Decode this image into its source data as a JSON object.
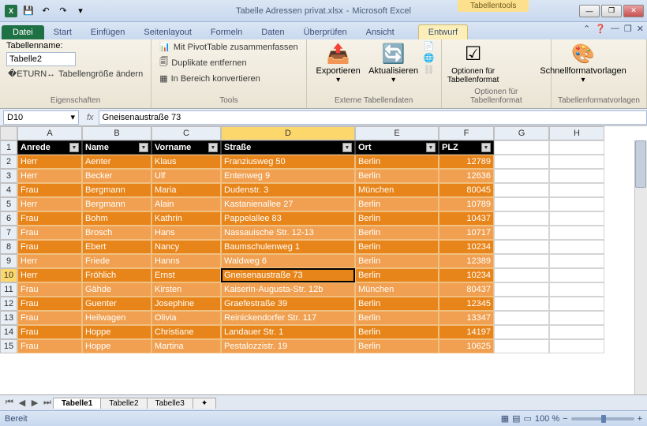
{
  "title": {
    "doc": "Tabelle Adressen privat.xlsx",
    "app": "Microsoft Excel",
    "contextual": "Tabellentools"
  },
  "qat": {
    "save": "💾",
    "undo": "↶",
    "redo": "↷"
  },
  "tabs": {
    "file": "Datei",
    "items": [
      "Start",
      "Einfügen",
      "Seitenlayout",
      "Formeln",
      "Daten",
      "Überprüfen",
      "Ansicht"
    ],
    "contextual": "Entwurf"
  },
  "ribbon": {
    "props": {
      "name_label": "Tabellenname:",
      "name_value": "Tabelle2",
      "resize": "Tabellengröße ändern",
      "group": "Eigenschaften"
    },
    "tools": {
      "pivot": "Mit PivotTable zusammenfassen",
      "dup": "Duplikate entfernen",
      "convert": "In Bereich konvertieren",
      "group": "Tools"
    },
    "external": {
      "export": "Exportieren",
      "refresh": "Aktualisieren",
      "group": "Externe Tabellendaten"
    },
    "styleopts": {
      "label": "Optionen für Tabellenformat",
      "group": "Optionen für Tabellenformat"
    },
    "styles": {
      "label": "Schnellformatvorlagen",
      "group": "Tabellenformatvorlagen"
    }
  },
  "namebox": "D10",
  "formula": "Gneisenaustraße 73",
  "fx": "fx",
  "cols": [
    "A",
    "B",
    "C",
    "D",
    "E",
    "F",
    "G",
    "H"
  ],
  "headers": [
    "Anrede",
    "Name",
    "Vorname",
    "Straße",
    "Ort",
    "PLZ"
  ],
  "rows": [
    {
      "n": 2,
      "a": "Herr",
      "b": "Aenter",
      "c": "Klaus",
      "d": "Franziusweg 50",
      "e": "Berlin",
      "f": "12789"
    },
    {
      "n": 3,
      "a": "Herr",
      "b": "Becker",
      "c": "Ulf",
      "d": "Entenweg 9",
      "e": "Berlin",
      "f": "12636"
    },
    {
      "n": 4,
      "a": "Frau",
      "b": "Bergmann",
      "c": "Maria",
      "d": "Dudenstr. 3",
      "e": "München",
      "f": "80045"
    },
    {
      "n": 5,
      "a": "Herr",
      "b": "Bergmann",
      "c": "Alain",
      "d": "Kastanienallee 27",
      "e": "Berlin",
      "f": "10789"
    },
    {
      "n": 6,
      "a": "Frau",
      "b": "Bohm",
      "c": "Kathrin",
      "d": "Pappelallee 83",
      "e": "Berlin",
      "f": "10437"
    },
    {
      "n": 7,
      "a": "Frau",
      "b": "Brosch",
      "c": "Hans",
      "d": "Nassauische Str. 12-13",
      "e": "Berlin",
      "f": "10717"
    },
    {
      "n": 8,
      "a": "Frau",
      "b": "Ebert",
      "c": "Nancy",
      "d": "Baumschulenweg 1",
      "e": "Berlin",
      "f": "10234"
    },
    {
      "n": 9,
      "a": "Herr",
      "b": "Friede",
      "c": "Hanns",
      "d": "Waldweg 6",
      "e": "Berlin",
      "f": "12389"
    },
    {
      "n": 10,
      "a": "Herr",
      "b": "Fröhlich",
      "c": "Ernst",
      "d": "Gneisenaustraße 73",
      "e": "Berlin",
      "f": "10234"
    },
    {
      "n": 11,
      "a": "Frau",
      "b": "Gähde",
      "c": "Kirsten",
      "d": "Kaiserin-Augusta-Str. 12b",
      "e": "München",
      "f": "80437"
    },
    {
      "n": 12,
      "a": "Frau",
      "b": "Guenter",
      "c": "Josephine",
      "d": "Graefestraße 39",
      "e": "Berlin",
      "f": "12345"
    },
    {
      "n": 13,
      "a": "Frau",
      "b": "Heilwagen",
      "c": "Olivia",
      "d": "Reinickendorfer Str. 117",
      "e": "Berlin",
      "f": "13347"
    },
    {
      "n": 14,
      "a": "Frau",
      "b": "Hoppe",
      "c": "Christiane",
      "d": "Landauer Str. 1",
      "e": "Berlin",
      "f": "14197"
    },
    {
      "n": 15,
      "a": "Frau",
      "b": "Hoppe",
      "c": "Martina",
      "d": "Pestalozzistr. 19",
      "e": "Berlin",
      "f": "10625"
    }
  ],
  "sheets": {
    "items": [
      "Tabelle1",
      "Tabelle2",
      "Tabelle3"
    ],
    "active": 0
  },
  "status": {
    "ready": "Bereit",
    "zoom": "100 %"
  }
}
